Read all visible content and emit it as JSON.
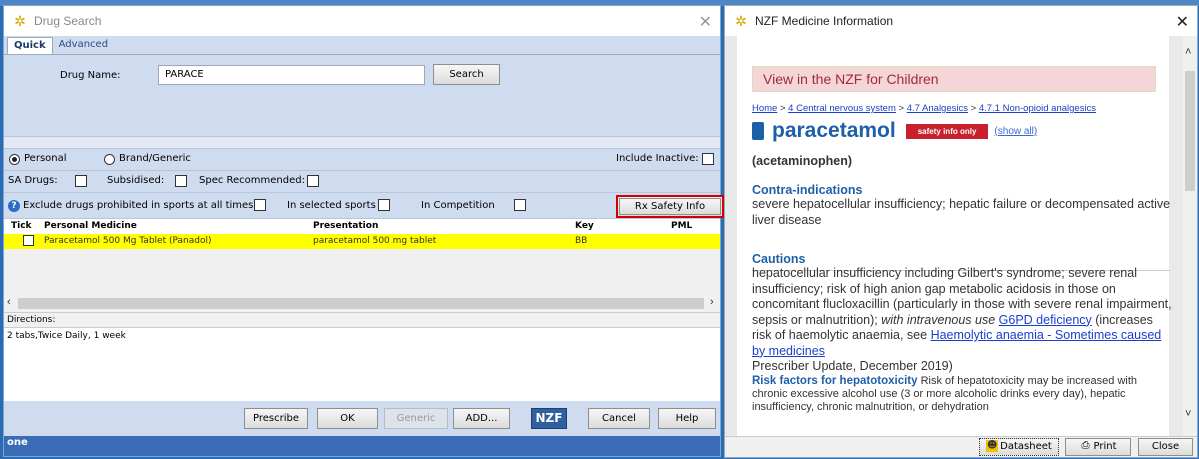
{
  "left_window": {
    "title": "Drug Search",
    "tabs": [
      "Quick",
      "Advanced"
    ],
    "drug_name_label": "Drug Name:",
    "drug_name_value": "PARACE",
    "search_label": "Search",
    "radio_personal": "Personal",
    "radio_brand": "Brand/Generic",
    "include_inactive": "Include Inactive:",
    "sa_drugs": "SA Drugs:",
    "subsidised": "Subsidised:",
    "spec_recommended": "Spec Recommended:",
    "exclude_sports": "Exclude drugs prohibited in sports at all times",
    "in_selected_sports": "In selected sports",
    "in_competition": "In Competition",
    "rx_safety": "Rx Safety Info",
    "table": {
      "headers": [
        "Tick",
        "Personal Medicine",
        "Presentation",
        "Key",
        "PML"
      ],
      "rows": [
        {
          "medicine": "Paracetamol 500 Mg Tablet (Panadol)",
          "presentation": "paracetamol 500 mg tablet",
          "key": "BB",
          "pml": ""
        }
      ]
    },
    "directions_label": "Directions:",
    "directions_text": "2 tabs,Twice Daily, 1 week",
    "buttons": {
      "prescribe": "Prescribe",
      "ok": "OK",
      "generic": "Generic",
      "add": "ADD...",
      "nzf": "NZF",
      "cancel": "Cancel",
      "help": "Help"
    },
    "bottom_text": "one"
  },
  "right_window": {
    "title": "NZF Medicine Information",
    "children_banner": "View in the NZF for Children",
    "breadcrumb": {
      "home": "Home",
      "sep": " > ",
      "c1": "4 Central nervous system",
      "c2": "4.7 Analgesics",
      "c3": "4.7.1 Non-opioid analgesics"
    },
    "drug_name": "paracetamol",
    "safety_badge": "safety info only",
    "show_all": "(show all)",
    "alt_name": "(acetaminophen)",
    "contra_heading": "Contra-indications",
    "contra_text": "severe hepatocellular insufficiency; hepatic failure or decompensated active liver disease",
    "cautions_heading": "Cautions",
    "cautions_text1": "hepatocellular insufficiency including Gilbert's syndrome; severe renal insufficiency; risk of high anion gap metabolic acidosis in those on concomitant flucloxacillin (particularly in those with severe renal impairment, sepsis or malnutrition);",
    "cautions_italic": "with intravenous use",
    "cautions_link1": "G6PD deficiency",
    "cautions_text2": "(increases risk of haemolytic anaemia, see",
    "cautions_link2": "Haemolytic anaemia - Sometimes caused by medicines",
    "cautions_text3": "Prescriber Update, December 2019)",
    "risk_heading": "Risk factors for hepatotoxicity",
    "risk_text": "Risk of hepatotoxicity may be increased with chronic excessive alcohol use (3 or more alcoholic drinks every day), hepatic insufficiency, chronic malnutrition, or dehydration",
    "footer": {
      "datasheet": "Datasheet",
      "print": "Print",
      "close": "Close"
    }
  },
  "colors": {
    "panel": "#cfdcef",
    "highlight_row": "#ffff00",
    "nzf_blue": "#1d5fa8",
    "safety_red": "#c8202c",
    "banner_pink": "#f4d6d9"
  }
}
